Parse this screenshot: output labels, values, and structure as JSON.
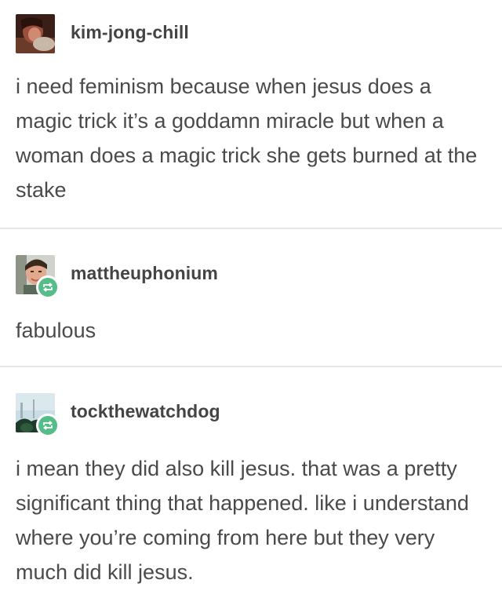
{
  "posts": [
    {
      "username": "kim-jong-chill",
      "reblogged": false,
      "text": "i need feminism because when jesus does a magic trick it’s a goddamn miracle but when a woman does a magic trick she gets burned at the stake"
    },
    {
      "username": "mattheuphonium",
      "reblogged": true,
      "text": "fabulous"
    },
    {
      "username": "tockthewatchdog",
      "reblogged": true,
      "text": "i mean they did also kill jesus. that was a pretty significant thing that happened. like i understand where you’re coming from here but they very much did kill jesus."
    }
  ],
  "colors": {
    "reblog_badge": "#56bc8a",
    "divider": "#e6e6e6",
    "text": "#444444"
  },
  "icons": {
    "reblog": "reblog-icon"
  }
}
